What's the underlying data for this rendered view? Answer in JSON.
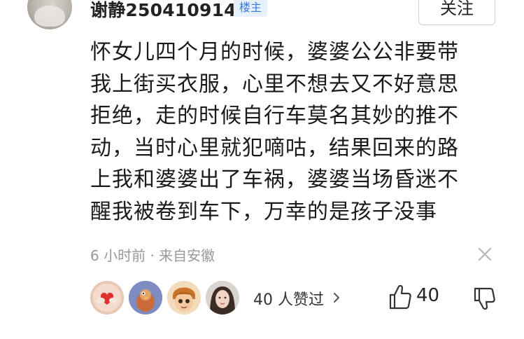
{
  "comment": {
    "username": "谢静250410914",
    "badge": "楼主",
    "follow_label": "关注",
    "text_lines": [
      "怀女儿四个月的时候，婆婆公公非要带",
      "我上街买衣服，心里不想去又不好意思",
      "拒绝，走的时候自行车莫名其妙的推不",
      "动，当时心里就犯嘀咕，结果回来的路",
      "上我和婆婆出了车祸，婆婆当场昏迷不",
      "醒我被卷到车下，万幸的是孩子没事"
    ],
    "meta": "6 小时前 · 来自安徽",
    "likers_summary": "40 人赞过",
    "like_count": "40"
  },
  "colors": {
    "badge_text": "#3a7ae0",
    "badge_bg": "#e7f0fd",
    "meta_gray": "#999999",
    "text": "#1a1a1a"
  },
  "icons": {
    "close": "close-icon",
    "chevron": "chevron-right-icon",
    "like": "thumbs-up-icon",
    "dislike": "thumbs-down-icon"
  }
}
